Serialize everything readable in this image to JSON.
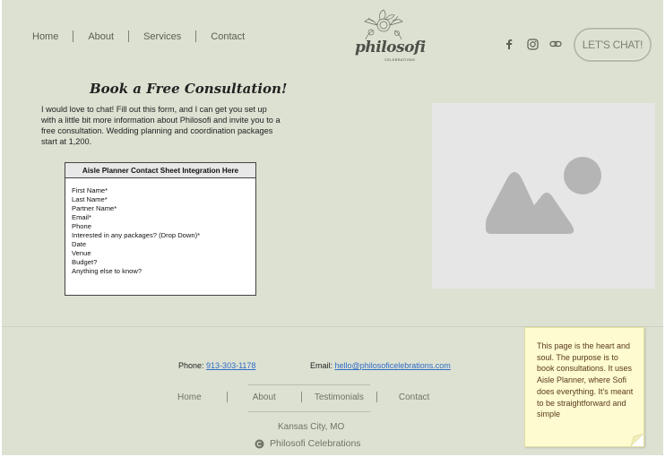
{
  "nav": {
    "items": [
      {
        "label": "Home"
      },
      {
        "label": "About"
      },
      {
        "label": "Services"
      },
      {
        "label": "Contact"
      }
    ]
  },
  "logo": {
    "name": "philosofi",
    "sub": "CELEBRATIONS"
  },
  "social": {
    "icons": [
      "facebook-icon",
      "instagram-icon",
      "link-icon"
    ]
  },
  "cta": {
    "label": "LET'S CHAT!"
  },
  "main": {
    "heading": "Book a Free Consultation!",
    "intro": "I would love to chat! Fill out this form, and I can get you set up with a little bit more information about Philosofi and invite you to a free consultation. Wedding planning and coordination packages start at 1,200."
  },
  "form": {
    "title": "Aisle Planner Contact Sheet Integration Here",
    "fields": [
      "First Name*",
      "Last Name*",
      "Partner Name*",
      "Email*",
      "Phone",
      "Interested in any packages? (Drop Down)*",
      "Date",
      "Venue",
      "Budget?",
      "Anything else to know?"
    ]
  },
  "footer": {
    "phone_label": "Phone:",
    "phone_value": "913-303-1178",
    "email_label": "Email:",
    "email_value": "hello@philosoficelebrations.com",
    "nav": [
      {
        "label": "Home"
      },
      {
        "label": "About"
      },
      {
        "label": "Testimonials"
      },
      {
        "label": "Contact"
      }
    ],
    "city": "Kansas City, MO",
    "copyright": "Philosofi Celebrations"
  },
  "note": {
    "text": "This page is the heart and soul. The purpose is to book consultations. It uses Aisle Planner, where Sofi does everything. It's meant to be straightforward and simple"
  },
  "colors": {
    "background": "#dde1d2",
    "link": "#2f6cc6",
    "note_bg": "#fdfbcf",
    "note_text": "#5b3a1b"
  }
}
